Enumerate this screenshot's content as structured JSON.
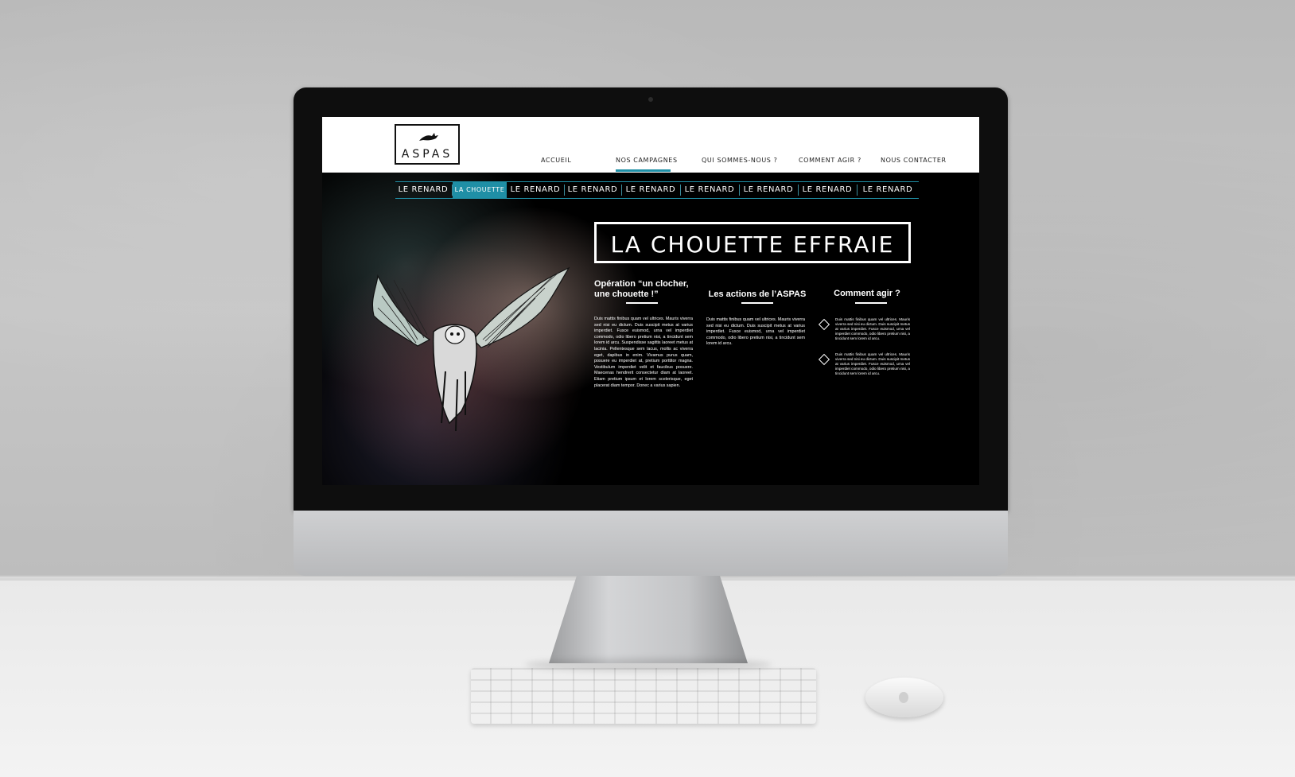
{
  "site": {
    "logo_text": "ASPAS",
    "accent_color": "#1f8fa6",
    "nav": [
      {
        "label": "ACCUEIL"
      },
      {
        "label": "NOS CAMPAGNES",
        "active": true
      },
      {
        "label": "QUI SOMMES-NOUS ?"
      },
      {
        "label": "COMMENT AGIR ?"
      },
      {
        "label": "NOUS CONTACTER"
      }
    ],
    "subnav": [
      {
        "label": "LE RENARD"
      },
      {
        "label": "LA CHOUETTE",
        "active": true
      },
      {
        "label": "LE RENARD"
      },
      {
        "label": "LE RENARD"
      },
      {
        "label": "LE RENARD"
      },
      {
        "label": "LE RENARD"
      },
      {
        "label": "LE RENARD"
      },
      {
        "label": "LE RENARD"
      },
      {
        "label": "LE RENARD"
      }
    ],
    "page_title": "LA CHOUETTE EFFRAIE",
    "columns": [
      {
        "heading": "Opération “un clocher, une chouette !”",
        "body": "Duis mattis finibus quam vel ultrices. Mauris viverra sed nisi eu dictum. Duis suscipit metus at varius imperdiet. Fusce euismod, urna vel imperdiet commodo, odio libero pretium nisi, a tincidunt sem lorem id arcu. Suspendisse sagittis laoreet metus at lacinia. Pellentesque sem lacus, mollis ac viverra eget, dapibus in enim. Vivamus purus quam, posuere eu imperdiet at, pretium porttitor magna. Vestibulum imperdiet velit et faucibus posuere. Maecenas hendrerit consectetur diam at laoreet. Etiam pretium ipsum et lorem scelerisque, eget placerat diam tempor. Donec a varius sapien."
      },
      {
        "heading": "Les actions de l’ASPAS",
        "body": "Duis mattis finibus quam vel ultrices. Mauris viverra sed nisi eu dictum. Duis suscipit metus at varius imperdiet. Fusce euismod, urna vel imperdiet commodo, odio libero pretium nisi, a tincidunt sem lorem id arcu."
      },
      {
        "heading": "Comment agir ?",
        "items": [
          "Duis mattis finibus quam vel ultrices. Mauris viverra sed nisi eu dictum. Duis suscipit metus at varius imperdiet. Fusce euismod, urna vel imperdiet commodo, odio libero pretium nisi, a tincidunt sem lorem id arcu.",
          "Duis mattis finibus quam vel ultrices. Mauris viverra sed nisi eu dictum. Duis suscipit metus at varius imperdiet. Fusce euismod, urna vel imperdiet commodo, odio libero pretium nisi, a tincidunt sem lorem id arcu."
        ]
      }
    ]
  }
}
